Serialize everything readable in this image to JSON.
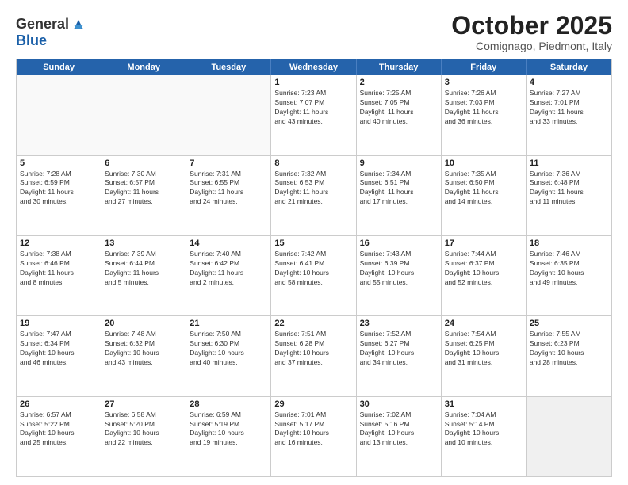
{
  "header": {
    "logo": {
      "line1": "General",
      "line2": "Blue"
    },
    "title": "October 2025",
    "subtitle": "Comignago, Piedmont, Italy"
  },
  "dayNames": [
    "Sunday",
    "Monday",
    "Tuesday",
    "Wednesday",
    "Thursday",
    "Friday",
    "Saturday"
  ],
  "weeks": [
    [
      {
        "day": "",
        "empty": true
      },
      {
        "day": "",
        "empty": true
      },
      {
        "day": "",
        "empty": true
      },
      {
        "day": "1",
        "info": "Sunrise: 7:23 AM\nSunset: 7:07 PM\nDaylight: 11 hours\nand 43 minutes."
      },
      {
        "day": "2",
        "info": "Sunrise: 7:25 AM\nSunset: 7:05 PM\nDaylight: 11 hours\nand 40 minutes."
      },
      {
        "day": "3",
        "info": "Sunrise: 7:26 AM\nSunset: 7:03 PM\nDaylight: 11 hours\nand 36 minutes."
      },
      {
        "day": "4",
        "info": "Sunrise: 7:27 AM\nSunset: 7:01 PM\nDaylight: 11 hours\nand 33 minutes."
      }
    ],
    [
      {
        "day": "5",
        "info": "Sunrise: 7:28 AM\nSunset: 6:59 PM\nDaylight: 11 hours\nand 30 minutes."
      },
      {
        "day": "6",
        "info": "Sunrise: 7:30 AM\nSunset: 6:57 PM\nDaylight: 11 hours\nand 27 minutes."
      },
      {
        "day": "7",
        "info": "Sunrise: 7:31 AM\nSunset: 6:55 PM\nDaylight: 11 hours\nand 24 minutes."
      },
      {
        "day": "8",
        "info": "Sunrise: 7:32 AM\nSunset: 6:53 PM\nDaylight: 11 hours\nand 21 minutes."
      },
      {
        "day": "9",
        "info": "Sunrise: 7:34 AM\nSunset: 6:51 PM\nDaylight: 11 hours\nand 17 minutes."
      },
      {
        "day": "10",
        "info": "Sunrise: 7:35 AM\nSunset: 6:50 PM\nDaylight: 11 hours\nand 14 minutes."
      },
      {
        "day": "11",
        "info": "Sunrise: 7:36 AM\nSunset: 6:48 PM\nDaylight: 11 hours\nand 11 minutes."
      }
    ],
    [
      {
        "day": "12",
        "info": "Sunrise: 7:38 AM\nSunset: 6:46 PM\nDaylight: 11 hours\nand 8 minutes."
      },
      {
        "day": "13",
        "info": "Sunrise: 7:39 AM\nSunset: 6:44 PM\nDaylight: 11 hours\nand 5 minutes."
      },
      {
        "day": "14",
        "info": "Sunrise: 7:40 AM\nSunset: 6:42 PM\nDaylight: 11 hours\nand 2 minutes."
      },
      {
        "day": "15",
        "info": "Sunrise: 7:42 AM\nSunset: 6:41 PM\nDaylight: 10 hours\nand 58 minutes."
      },
      {
        "day": "16",
        "info": "Sunrise: 7:43 AM\nSunset: 6:39 PM\nDaylight: 10 hours\nand 55 minutes."
      },
      {
        "day": "17",
        "info": "Sunrise: 7:44 AM\nSunset: 6:37 PM\nDaylight: 10 hours\nand 52 minutes."
      },
      {
        "day": "18",
        "info": "Sunrise: 7:46 AM\nSunset: 6:35 PM\nDaylight: 10 hours\nand 49 minutes."
      }
    ],
    [
      {
        "day": "19",
        "info": "Sunrise: 7:47 AM\nSunset: 6:34 PM\nDaylight: 10 hours\nand 46 minutes."
      },
      {
        "day": "20",
        "info": "Sunrise: 7:48 AM\nSunset: 6:32 PM\nDaylight: 10 hours\nand 43 minutes."
      },
      {
        "day": "21",
        "info": "Sunrise: 7:50 AM\nSunset: 6:30 PM\nDaylight: 10 hours\nand 40 minutes."
      },
      {
        "day": "22",
        "info": "Sunrise: 7:51 AM\nSunset: 6:28 PM\nDaylight: 10 hours\nand 37 minutes."
      },
      {
        "day": "23",
        "info": "Sunrise: 7:52 AM\nSunset: 6:27 PM\nDaylight: 10 hours\nand 34 minutes."
      },
      {
        "day": "24",
        "info": "Sunrise: 7:54 AM\nSunset: 6:25 PM\nDaylight: 10 hours\nand 31 minutes."
      },
      {
        "day": "25",
        "info": "Sunrise: 7:55 AM\nSunset: 6:23 PM\nDaylight: 10 hours\nand 28 minutes."
      }
    ],
    [
      {
        "day": "26",
        "info": "Sunrise: 6:57 AM\nSunset: 5:22 PM\nDaylight: 10 hours\nand 25 minutes."
      },
      {
        "day": "27",
        "info": "Sunrise: 6:58 AM\nSunset: 5:20 PM\nDaylight: 10 hours\nand 22 minutes."
      },
      {
        "day": "28",
        "info": "Sunrise: 6:59 AM\nSunset: 5:19 PM\nDaylight: 10 hours\nand 19 minutes."
      },
      {
        "day": "29",
        "info": "Sunrise: 7:01 AM\nSunset: 5:17 PM\nDaylight: 10 hours\nand 16 minutes."
      },
      {
        "day": "30",
        "info": "Sunrise: 7:02 AM\nSunset: 5:16 PM\nDaylight: 10 hours\nand 13 minutes."
      },
      {
        "day": "31",
        "info": "Sunrise: 7:04 AM\nSunset: 5:14 PM\nDaylight: 10 hours\nand 10 minutes."
      },
      {
        "day": "",
        "empty": true,
        "lastRow": true
      }
    ]
  ]
}
